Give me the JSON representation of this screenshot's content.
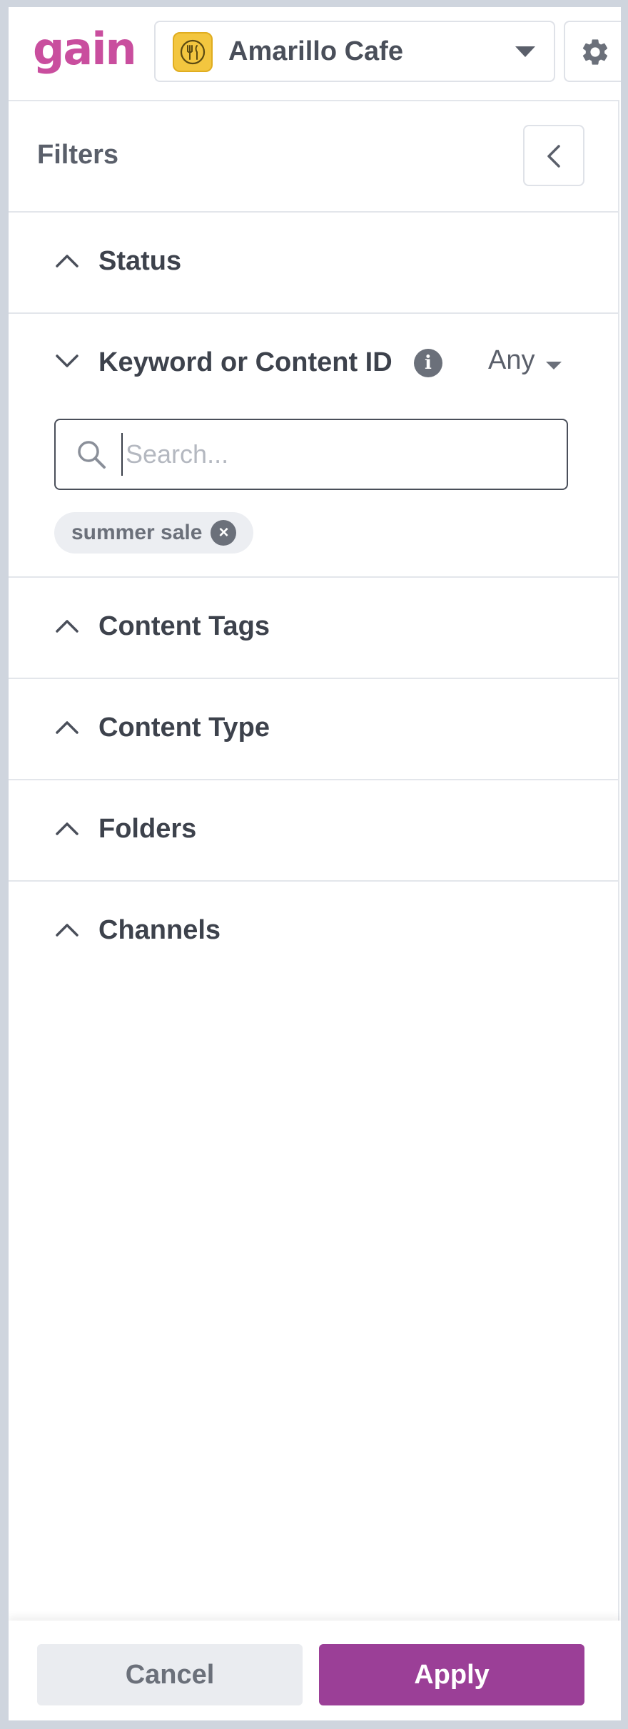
{
  "header": {
    "logo_text": "gain",
    "account_name": "Amarillo Cafe",
    "account_icon": "fork-spoon-icon",
    "settings_icon": "gear-icon"
  },
  "filters_panel": {
    "title": "Filters",
    "collapse_icon": "chevron-left-icon",
    "sections": [
      {
        "label": "Status",
        "expanded": false
      },
      {
        "label": "Keyword or Content ID",
        "expanded": true,
        "info_icon": "info-icon",
        "match_mode": "Any",
        "search_placeholder": "Search...",
        "search_value": "",
        "chips": [
          {
            "label": "summer sale"
          }
        ]
      },
      {
        "label": "Content Tags",
        "expanded": false
      },
      {
        "label": "Content Type",
        "expanded": false
      },
      {
        "label": "Folders",
        "expanded": false
      },
      {
        "label": "Channels",
        "expanded": false
      }
    ]
  },
  "footer": {
    "cancel_label": "Cancel",
    "apply_label": "Apply"
  },
  "colors": {
    "brand": "#c94e9e",
    "apply_button": "#9b3f97",
    "avatar_bg": "#f3c63f"
  }
}
